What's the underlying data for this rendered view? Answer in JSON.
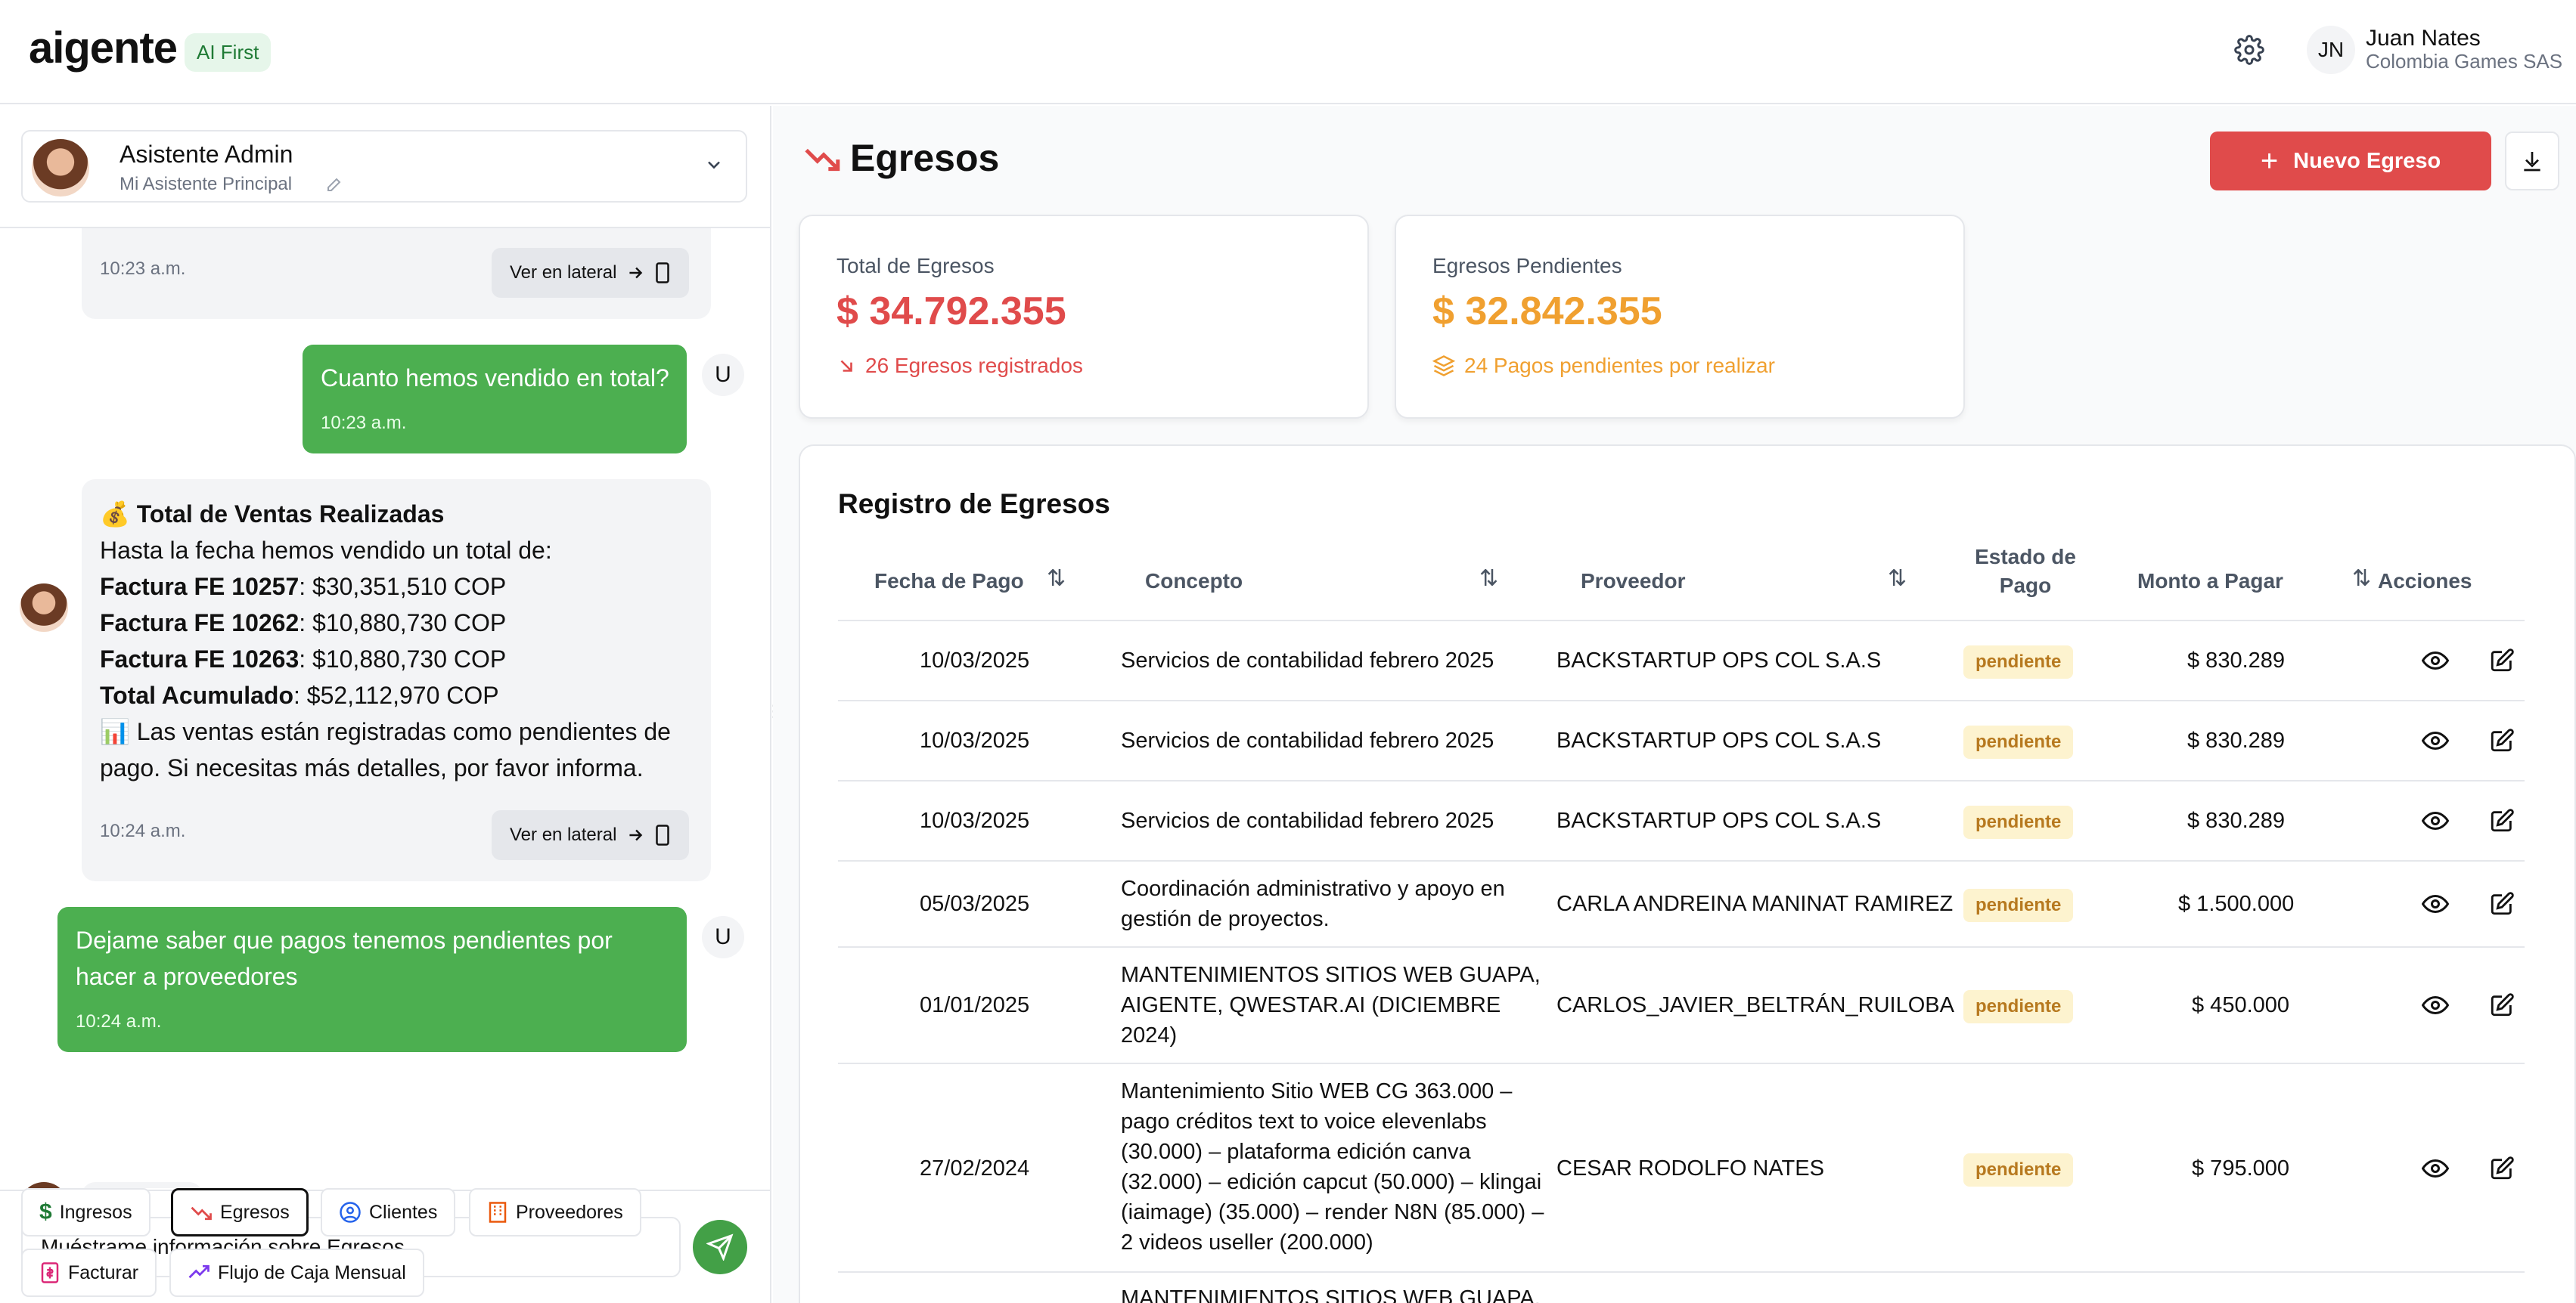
{
  "header": {
    "logo": "aigente",
    "badge": "AI First",
    "user_initials": "JN",
    "user_name": "Juan Nates",
    "user_company": "Colombia Games SAS"
  },
  "assistant": {
    "name": "Asistente Admin",
    "subtitle": "Mi Asistente Principal"
  },
  "chat": {
    "view_side_label": "Ver en lateral",
    "user_badge": "U",
    "messages": [
      {
        "role": "ai",
        "time": "10:23 a.m."
      },
      {
        "role": "user",
        "text": "Cuanto hemos vendido en total?",
        "time": "10:23 a.m."
      },
      {
        "role": "ai",
        "title": "💰 Total de Ventas Realizadas",
        "intro": "Hasta la fecha hemos vendido un total de:",
        "lines": [
          {
            "label": "Factura FE 10257",
            "value": ": $30,351,510 COP"
          },
          {
            "label": "Factura FE 10262",
            "value": ": $10,880,730 COP"
          },
          {
            "label": "Factura FE 10263",
            "value": ": $10,880,730 COP"
          },
          {
            "label": "Total Acumulado",
            "value": ": $52,112,970 COP"
          }
        ],
        "footer_1": "📊 Las ventas están registradas como pendientes de",
        "footer_2": "pago. Si necesitas más detalles, por favor informa.",
        "time": "10:24 a.m."
      },
      {
        "role": "user",
        "text_1": "Dejame saber que pagos tenemos pendientes por",
        "text_2": "hacer a proveedores",
        "time": "10:24 a.m."
      }
    ]
  },
  "composer": {
    "input_value": "Muéstrame información sobre Egresos"
  },
  "quick_actions": [
    {
      "label": "Ingresos",
      "icon": "dollar-icon"
    },
    {
      "label": "Egresos",
      "icon": "trend-down-icon"
    },
    {
      "label": "Clientes",
      "icon": "user-circle-icon"
    },
    {
      "label": "Proveedores",
      "icon": "building-icon"
    },
    {
      "label": "Facturar",
      "icon": "invoice-icon"
    },
    {
      "label": "Flujo de Caja Mensual",
      "icon": "trend-up-icon"
    }
  ],
  "page": {
    "title": "Egresos",
    "new_button": "Nuevo Egreso"
  },
  "stats": [
    {
      "label": "Total de Egresos",
      "value": "$ 34.792.355",
      "note": "26 Egresos registrados",
      "color": "#e04b4b"
    },
    {
      "label": "Egresos Pendientes",
      "value": "$ 32.842.355",
      "note": "24 Pagos pendientes por realizar",
      "color": "#f0a030"
    }
  ],
  "table": {
    "title": "Registro de Egresos",
    "headers": {
      "fecha": "Fecha de Pago",
      "concepto": "Concepto",
      "proveedor": "Proveedor",
      "estado_1": "Estado de",
      "estado_2": "Pago",
      "monto": "Monto a Pagar",
      "acciones": "Acciones"
    },
    "rows": [
      {
        "fecha": "10/03/2025",
        "concepto": [
          "Servicios de contabilidad febrero 2025"
        ],
        "proveedor": "BACKSTARTUP OPS COL S.A.S",
        "estado": "pendiente",
        "monto": "$ 830.289"
      },
      {
        "fecha": "10/03/2025",
        "concepto": [
          "Servicios de contabilidad febrero 2025"
        ],
        "proveedor": "BACKSTARTUP OPS COL S.A.S",
        "estado": "pendiente",
        "monto": "$ 830.289"
      },
      {
        "fecha": "10/03/2025",
        "concepto": [
          "Servicios de contabilidad febrero 2025"
        ],
        "proveedor": "BACKSTARTUP OPS COL S.A.S",
        "estado": "pendiente",
        "monto": "$ 830.289"
      },
      {
        "fecha": "05/03/2025",
        "concepto": [
          "Coordinación administrativo y apoyo en",
          "gestión de proyectos."
        ],
        "proveedor": "CARLA ANDREINA MANINAT RAMIREZ",
        "estado": "pendiente",
        "monto": "$ 1.500.000"
      },
      {
        "fecha": "01/01/2025",
        "concepto": [
          "MANTENIMIENTOS SITIOS WEB GUAPA,",
          "AIGENTE, QWESTAR.AI (DICIEMBRE",
          "2024)"
        ],
        "proveedor": "CARLOS_JAVIER_BELTRÁN_RUILOBA",
        "estado": "pendiente",
        "monto": "$ 450.000"
      },
      {
        "fecha": "27/02/2024",
        "concepto": [
          "Mantenimiento Sitio WEB CG 363.000 –",
          "pago créditos text to voice elevenlabs",
          "(30.000) – plataforma edición canva",
          "(32.000) – edición capcut (50.000) – klingai",
          "(iaimage) (35.000) – render N8N (85.000) –",
          "2 videos useller (200.000)"
        ],
        "proveedor": "CESAR RODOLFO NATES",
        "estado": "pendiente",
        "monto": "$ 795.000"
      },
      {
        "fecha": "",
        "concepto": [
          "MANTENIMIENTOS SITIOS WEB GUAPA,"
        ],
        "proveedor": "",
        "estado": "",
        "monto": ""
      }
    ]
  }
}
